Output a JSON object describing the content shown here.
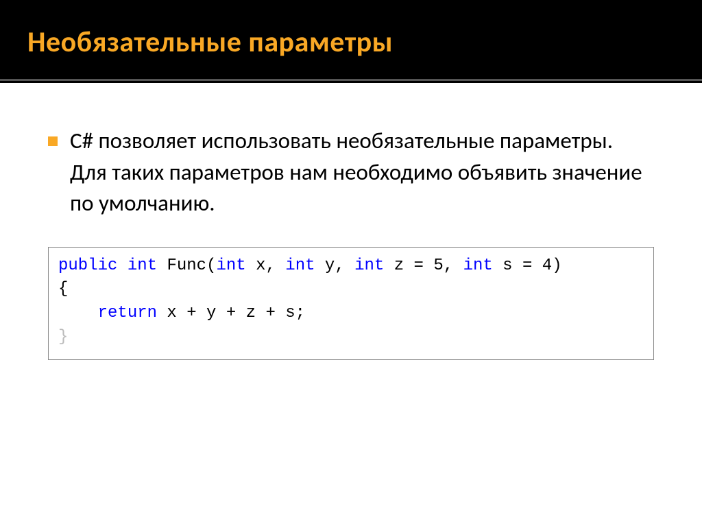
{
  "title": "Необязательные параметры",
  "bullet": "C# позволяет использовать необязательные параметры. Для таких параметров нам необходимо объявить значение по умолчанию.",
  "code": {
    "t_public": "public",
    "t_int": "int",
    "t_func": " Func(",
    "t_intx": "int",
    "t_x": " x, ",
    "t_inty": "int",
    "t_y": " y, ",
    "t_intz": "int",
    "t_z": " z = 5, ",
    "t_ints": "int",
    "t_s": " s = 4)",
    "brace_open": "{",
    "t_return": "return",
    "t_expr": " x + y + z + s;",
    "brace_close": "}"
  }
}
